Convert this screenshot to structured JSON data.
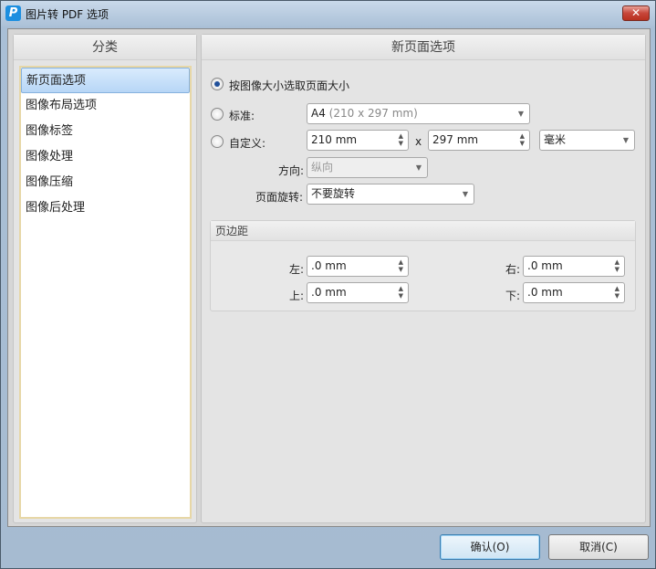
{
  "window": {
    "title": "图片转 PDF 选项",
    "app_icon": "P",
    "close_label": "✕"
  },
  "sidebar": {
    "header": "分类",
    "items": [
      {
        "label": "新页面选项",
        "selected": true
      },
      {
        "label": "图像布局选项"
      },
      {
        "label": "图像标签"
      },
      {
        "label": "图像处理"
      },
      {
        "label": "图像压缩"
      },
      {
        "label": "图像后处理"
      }
    ]
  },
  "main": {
    "header": "新页面选项",
    "radio_by_image": "按图像大小选取页面大小",
    "radio_standard": "标准:",
    "standard_value": "A4",
    "standard_detail": "(210 x 297 mm)",
    "radio_custom": "自定义:",
    "width_value": "210 mm",
    "times": "x",
    "height_value": "297 mm",
    "unit_value": "毫米",
    "orientation_label": "方向:",
    "orientation_value": "纵向",
    "rotation_label": "页面旋转:",
    "rotation_value": "不要旋转",
    "margins": {
      "header": "页边距",
      "left_label": "左:",
      "left_value": ".0 mm",
      "right_label": "右:",
      "right_value": ".0 mm",
      "top_label": "上:",
      "top_value": ".0 mm",
      "bottom_label": "下:",
      "bottom_value": ".0 mm"
    }
  },
  "footer": {
    "ok": "确认(O)",
    "cancel": "取消(C)"
  }
}
